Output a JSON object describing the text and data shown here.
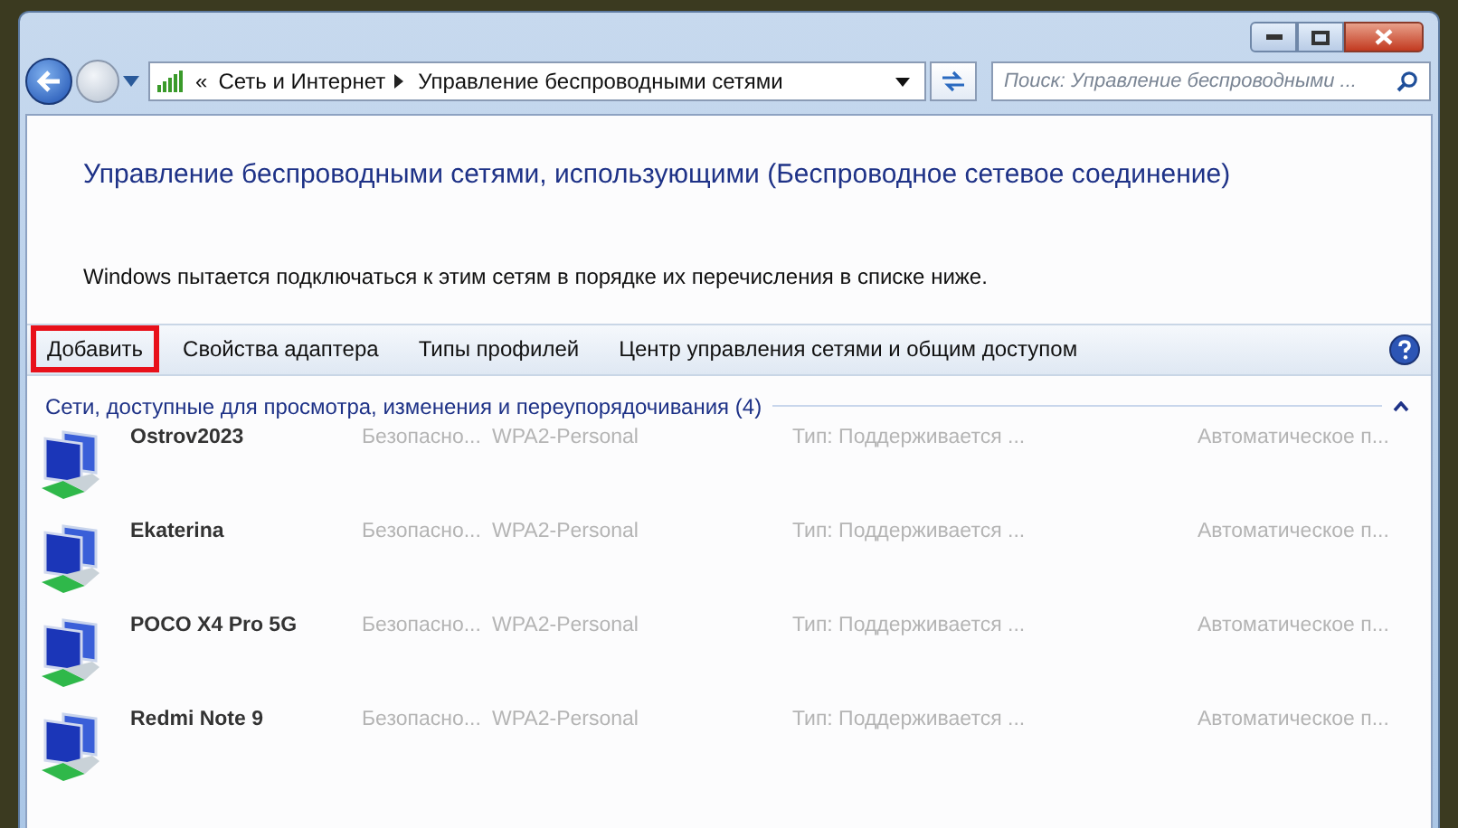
{
  "address_bar": {
    "overflow": "«",
    "crumbs": [
      "Сеть и Интернет",
      "Управление беспроводными сетями"
    ]
  },
  "search": {
    "placeholder": "Поиск: Управление беспроводными ..."
  },
  "heading": "Управление беспроводными сетями, использующими (Беспроводное сетевое соединение)",
  "description": "Windows пытается подключаться к этим сетям в порядке их перечисления в списке ниже.",
  "toolbar": [
    {
      "label": "Добавить",
      "highlighted": true
    },
    {
      "label": "Свойства адаптера",
      "highlighted": false
    },
    {
      "label": "Типы профилей",
      "highlighted": false
    },
    {
      "label": "Центр управления сетями и общим доступом",
      "highlighted": false
    }
  ],
  "group": {
    "title": "Сети, доступные для просмотра, изменения и переупорядочивания (4)",
    "expanded": true
  },
  "networks": [
    {
      "name": "Ostrov2023",
      "security": "Безопасно...",
      "encryption": "WPA2-Personal",
      "type": "Тип: Поддерживается ...",
      "mode": "Автоматическое п..."
    },
    {
      "name": "Ekaterina",
      "security": "Безопасно...",
      "encryption": "WPA2-Personal",
      "type": "Тип: Поддерживается ...",
      "mode": "Автоматическое п..."
    },
    {
      "name": "POCO X4 Pro 5G",
      "security": "Безопасно...",
      "encryption": "WPA2-Personal",
      "type": "Тип: Поддерживается ...",
      "mode": "Автоматическое п..."
    },
    {
      "name": "Redmi Note 9",
      "security": "Безопасно...",
      "encryption": "WPA2-Personal",
      "type": "Тип: Поддерживается ...",
      "mode": "Автоматическое п..."
    }
  ]
}
